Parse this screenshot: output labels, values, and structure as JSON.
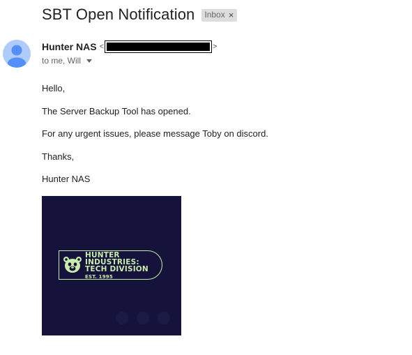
{
  "email": {
    "subject": "SBT Open Notification",
    "label": "Inbox",
    "label_remove": "×",
    "sender_name": "Hunter NAS",
    "sender_open": "<",
    "sender_close": ">",
    "recipients": "to me, Will",
    "body": {
      "greeting": "Hello,",
      "line1": "The Server Backup Tool has opened.",
      "line2": "For any urgent issues, please message Toby on discord.",
      "closing": "Thanks,",
      "signature": "Hunter NAS"
    }
  },
  "logo": {
    "line1": "HUNTER",
    "line2": "INDUSTRIES:",
    "line3": "TECH DIVISION",
    "line4": "EST. 1995",
    "background_color": "#15133b",
    "accent_color": "#c8edaa"
  },
  "icons": {
    "avatar": "default-person-avatar",
    "dropdown": "caret-down-icon",
    "mascot": "bear-head-icon"
  }
}
